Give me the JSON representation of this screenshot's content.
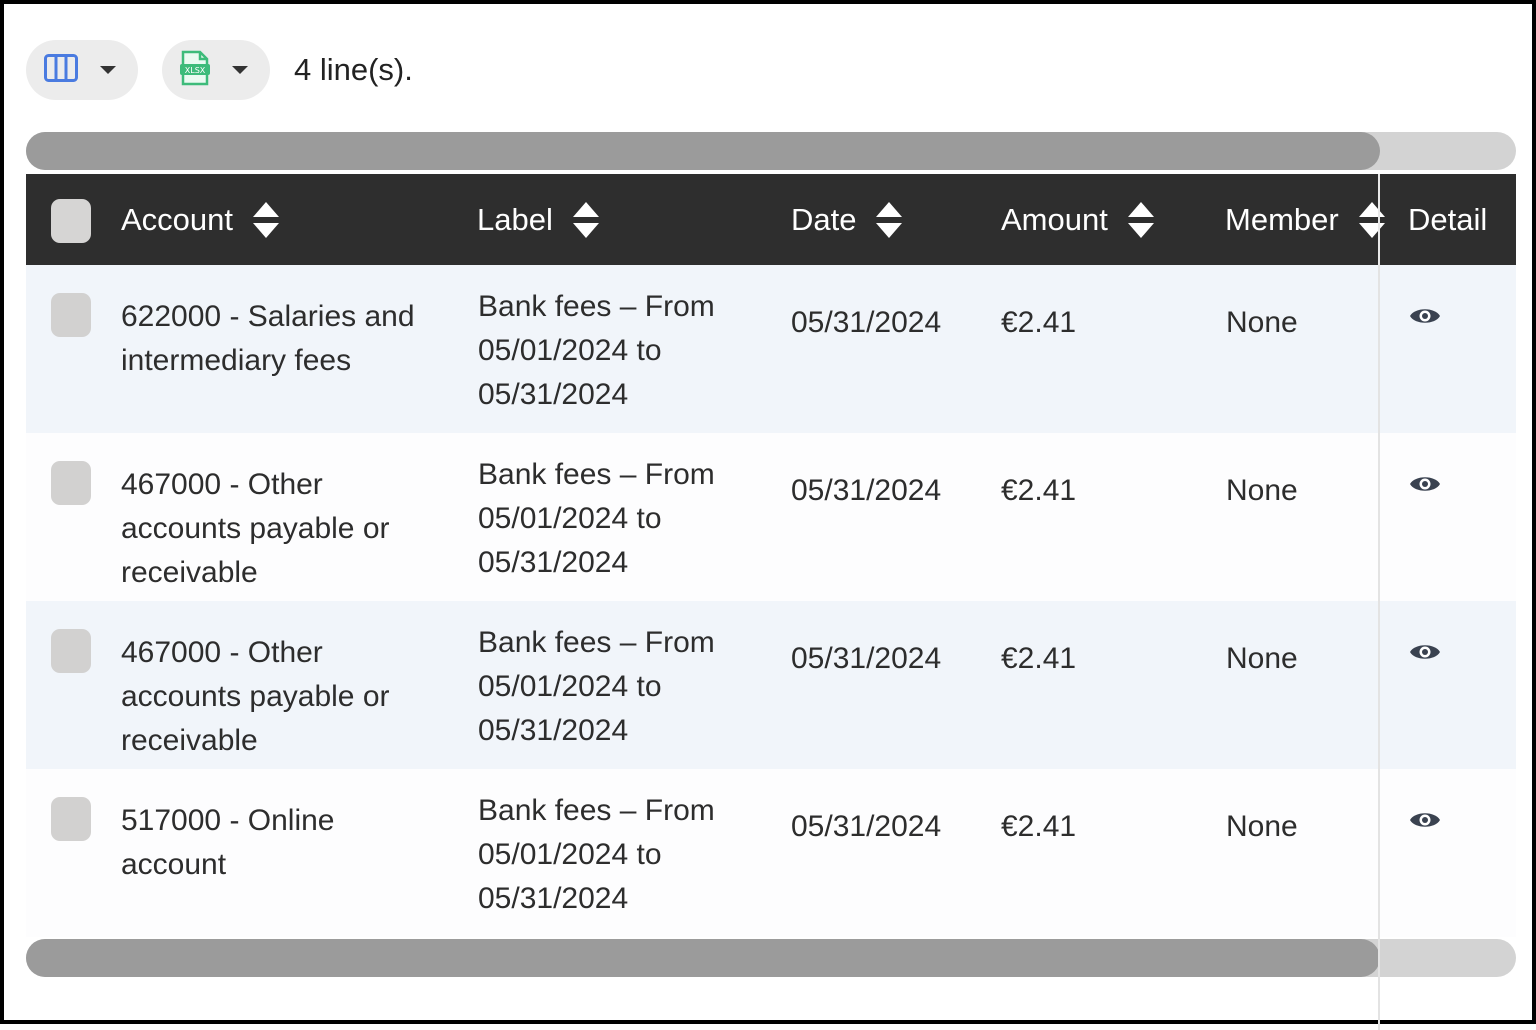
{
  "toolbar": {
    "columns_icon": "columns-icon",
    "export_icon": "xlsx-file-icon",
    "lines_count": "4 line(s)."
  },
  "table": {
    "headers": {
      "account": "Account",
      "label": "Label",
      "date": "Date",
      "amount": "Amount",
      "member": "Member",
      "detail": "Detail"
    },
    "rows": [
      {
        "account": "622000 - Salaries and intermediary fees",
        "label": "Bank fees – From 05/01/2024 to 05/31/2024",
        "date": "05/31/2024",
        "amount": "€2.41",
        "member": "None"
      },
      {
        "account": "467000 - Other accounts payable or receivable",
        "label": "Bank fees – From 05/01/2024 to 05/31/2024",
        "date": "05/31/2024",
        "amount": "€2.41",
        "member": "None"
      },
      {
        "account": "467000 - Other accounts payable or receivable",
        "label": "Bank fees – From 05/01/2024 to 05/31/2024",
        "date": "05/31/2024",
        "amount": "€2.41",
        "member": "None"
      },
      {
        "account": "517000 - Online account",
        "label": "Bank fees – From 05/01/2024 to 05/31/2024",
        "date": "05/31/2024",
        "amount": "€2.41",
        "member": "None"
      }
    ]
  },
  "colors": {
    "header_bg": "#2e2e2e",
    "row_alt_bg": "#f1f5fa",
    "columns_icon": "#4a7be0",
    "xlsx_icon": "#3dbb7a",
    "scroll_thumb": "#9b9b9b",
    "scroll_track": "#d3d3d3"
  }
}
